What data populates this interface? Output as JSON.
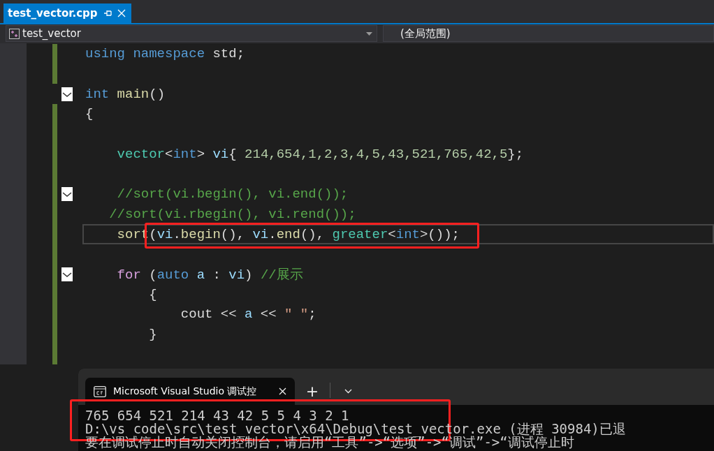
{
  "document_tabs": [
    {
      "label": "test_vector.cpp",
      "selected": true
    }
  ],
  "navigation": {
    "project": "test_vector",
    "scope": "(全局范围)"
  },
  "code_lines": [
    {
      "changed": true,
      "current": false,
      "tokens": [
        {
          "kind": "kw",
          "text": "using namespace"
        },
        {
          "kind": "plain",
          "text": " std;"
        }
      ]
    },
    {
      "changed": true,
      "current": false
    },
    {
      "changed": false,
      "current": false,
      "fold_expanded": true,
      "tokens": [
        {
          "kind": "kw",
          "text": "int"
        },
        {
          "kind": "fn",
          "text": " main"
        },
        {
          "kind": "plain",
          "text": "()"
        }
      ]
    },
    {
      "changed": true,
      "current": false,
      "tokens": [
        {
          "kind": "plain",
          "text": "{"
        }
      ]
    },
    {
      "changed": true,
      "current": false
    },
    {
      "changed": true,
      "current": false,
      "tokens": [
        {
          "kind": "type",
          "text": "    vector"
        },
        {
          "kind": "plain",
          "text": "<"
        },
        {
          "kind": "kw",
          "text": "int"
        },
        {
          "kind": "plain",
          "text": "> "
        },
        {
          "kind": "var",
          "text": "vi"
        },
        {
          "kind": "plain",
          "text": "{ "
        },
        {
          "kind": "num",
          "text": "214,654,1,2,3,4,5,43,521,765,42,5"
        },
        {
          "kind": "plain",
          "text": "};"
        }
      ]
    },
    {
      "changed": true,
      "current": false
    },
    {
      "changed": true,
      "current": false,
      "fold_expanded": true,
      "tokens": [
        {
          "kind": "cmt",
          "text": "    //sort(vi.begin(), vi.end());"
        }
      ]
    },
    {
      "changed": true,
      "current": false,
      "tokens": [
        {
          "kind": "cmt",
          "text": "   //sort(vi.rbegin(), vi.rend());"
        }
      ]
    },
    {
      "changed": true,
      "current": true,
      "tokens": [
        {
          "kind": "fn",
          "text": "    sort"
        }
      ],
      "boxed_tokens": [
        {
          "kind": "plain",
          "text": "("
        },
        {
          "kind": "var",
          "text": "vi"
        },
        {
          "kind": "plain",
          "text": "."
        },
        {
          "kind": "fn",
          "text": "begin"
        },
        {
          "kind": "plain",
          "text": "(), "
        },
        {
          "kind": "var",
          "text": "vi"
        },
        {
          "kind": "plain",
          "text": "."
        },
        {
          "kind": "fn",
          "text": "end"
        },
        {
          "kind": "plain",
          "text": "(), "
        },
        {
          "kind": "type",
          "text": "greater"
        },
        {
          "kind": "plain",
          "text": "<"
        },
        {
          "kind": "kw",
          "text": "int"
        },
        {
          "kind": "plain",
          "text": ">());"
        }
      ]
    },
    {
      "changed": true,
      "current": false
    },
    {
      "changed": true,
      "current": false,
      "fold_expanded": true,
      "tokens": [
        {
          "kind": "ctl",
          "text": "    for"
        },
        {
          "kind": "plain",
          "text": " ("
        },
        {
          "kind": "kw",
          "text": "auto"
        },
        {
          "kind": "var",
          "text": " a"
        },
        {
          "kind": "plain",
          "text": " : "
        },
        {
          "kind": "var",
          "text": "vi"
        },
        {
          "kind": "plain",
          "text": ") "
        },
        {
          "kind": "cmt",
          "text": "//展示"
        }
      ]
    },
    {
      "changed": true,
      "current": false,
      "tokens": [
        {
          "kind": "plain",
          "text": "        {"
        }
      ]
    },
    {
      "changed": true,
      "current": false,
      "tokens": [
        {
          "kind": "plain",
          "text": "            cout << "
        },
        {
          "kind": "var",
          "text": "a"
        },
        {
          "kind": "plain",
          "text": " << "
        },
        {
          "kind": "str",
          "text": "\" \""
        },
        {
          "kind": "plain",
          "text": ";"
        }
      ]
    },
    {
      "changed": true,
      "current": false,
      "tokens": [
        {
          "kind": "plain",
          "text": "        }"
        }
      ]
    },
    {
      "changed": true,
      "current": false
    }
  ],
  "console": {
    "tab_title": "Microsoft Visual Studio 调试控",
    "new_tab": "+",
    "lines": [
      {
        "text": "765 654 521 214 43 42 5 5 4 3 2 1",
        "marked": true
      },
      {
        "text": "D:\\vs code\\src\\test_vector\\x64\\Debug\\test_vector.exe (进程 30984)已退",
        "marked": false
      },
      {
        "text": "要在调试停止时自动关闭控制台，请启用“工具”->“选项”->“调试”->“调试停止时",
        "marked": false
      }
    ]
  }
}
